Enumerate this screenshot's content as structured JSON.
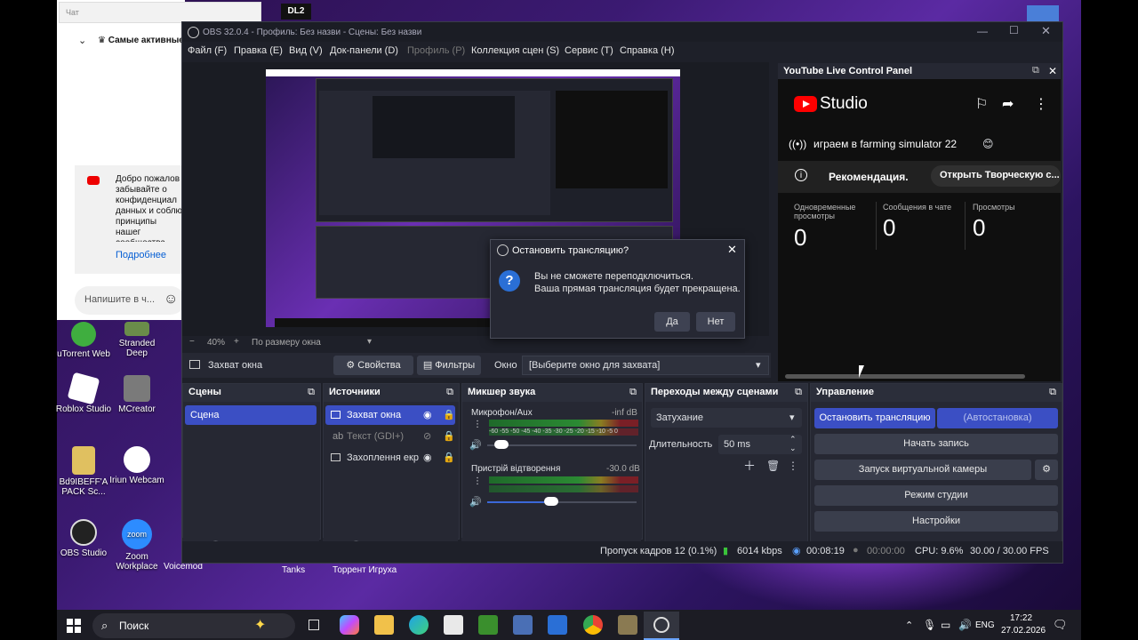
{
  "window": {
    "title": "OBS 32.0.4 - Профиль: Без назви - Сцены: Без назви"
  },
  "menu": [
    "Файл (F)",
    "Правка (E)",
    "Вид (V)",
    "Док-панели (D)",
    "Профиль (P)",
    "Коллекция сцен (S)",
    "Сервис (T)",
    "Справка (H)"
  ],
  "preview": {
    "zoom": "40%",
    "fit": "По размеру окна"
  },
  "source_toolbar": {
    "source_name": "Захват окна",
    "properties": "Свойства",
    "filters": "Фильтры",
    "window_label": "Окно",
    "window_value": "[Выберите окно для захвата]"
  },
  "scenes": {
    "title": "Сцены",
    "items": [
      "Сцена"
    ]
  },
  "sources": {
    "title": "Источники",
    "items": [
      "Захват окна",
      "Текст (GDI+)",
      "Захоплення екр"
    ]
  },
  "mixer": {
    "title": "Микшер звука",
    "channels": [
      {
        "name": "Микрофон/Aux",
        "level": "-inf dB",
        "volume": 0.05
      },
      {
        "name": "Пристрій відтворення",
        "level": "-30.0 dB",
        "volume": 0.38
      }
    ],
    "ticks": [
      "-60",
      "-55",
      "-50",
      "-45",
      "-40",
      "-35",
      "-30",
      "-25",
      "-20",
      "-15",
      "-10",
      "-5",
      "0"
    ]
  },
  "transitions": {
    "title": "Переходы между сценами",
    "type": "Затухание",
    "duration_label": "Длительность",
    "duration": "50 ms"
  },
  "controls": {
    "title": "Управление",
    "stop_stream": "Остановить трансляцию",
    "auto_stop": "(Автостановка)",
    "start_record": "Начать запись",
    "virtual_cam": "Запуск виртуальной камеры",
    "studio_mode": "Режим студии",
    "settings": "Настройки"
  },
  "statusbar": {
    "dropped": "Пропуск кадров 12 (0.1%)",
    "bitrate": "6014 kbps",
    "stream_time": "00:08:19",
    "record_time": "00:00:00",
    "cpu": "CPU: 9.6%",
    "fps": "30.00 / 30.00 FPS"
  },
  "youtube": {
    "panel_title": "YouTube Live Control Panel",
    "logo_text": "Studio",
    "stream_title": "играем в farming simulator 22",
    "recommendation": "Рекомендация.",
    "open_studio": "Открыть Творческую с...",
    "stats": [
      {
        "label": "Одновременные просмотры",
        "value": "0"
      },
      {
        "label": "Сообщения в чате",
        "value": "0"
      },
      {
        "label": "Просмотры",
        "value": "0"
      }
    ]
  },
  "dialog": {
    "title": "Остановить трансляцию?",
    "line1": "Вы не сможете переподключиться.",
    "line2": "Ваша прямая трансляция будет прекращена.",
    "yes": "Да",
    "no": "Нет"
  },
  "chat": {
    "placeholder_top": "Чат",
    "top_chats": "Самые активные",
    "welcome": "Добро пожалов забывайте о конфиденциал данных и соблю принципы нашег сообщества.",
    "more": "Подробнее",
    "input": "Напишите в ч..."
  },
  "desktop_icons": [
    "uTorrent Web",
    "Stranded Deep",
    "Roblox Studio",
    "MCreator",
    "Bd9IBEFF'A PACK Sc...",
    "Iriun Webcam",
    "OBS Studio",
    "Zoom Workplace",
    "Voicemod",
    "Tanks",
    "Торрент Игруха"
  ],
  "taskbar": {
    "search": "Поиск",
    "lang": "ENG",
    "time": "17:22",
    "date": "27.02.2026"
  }
}
